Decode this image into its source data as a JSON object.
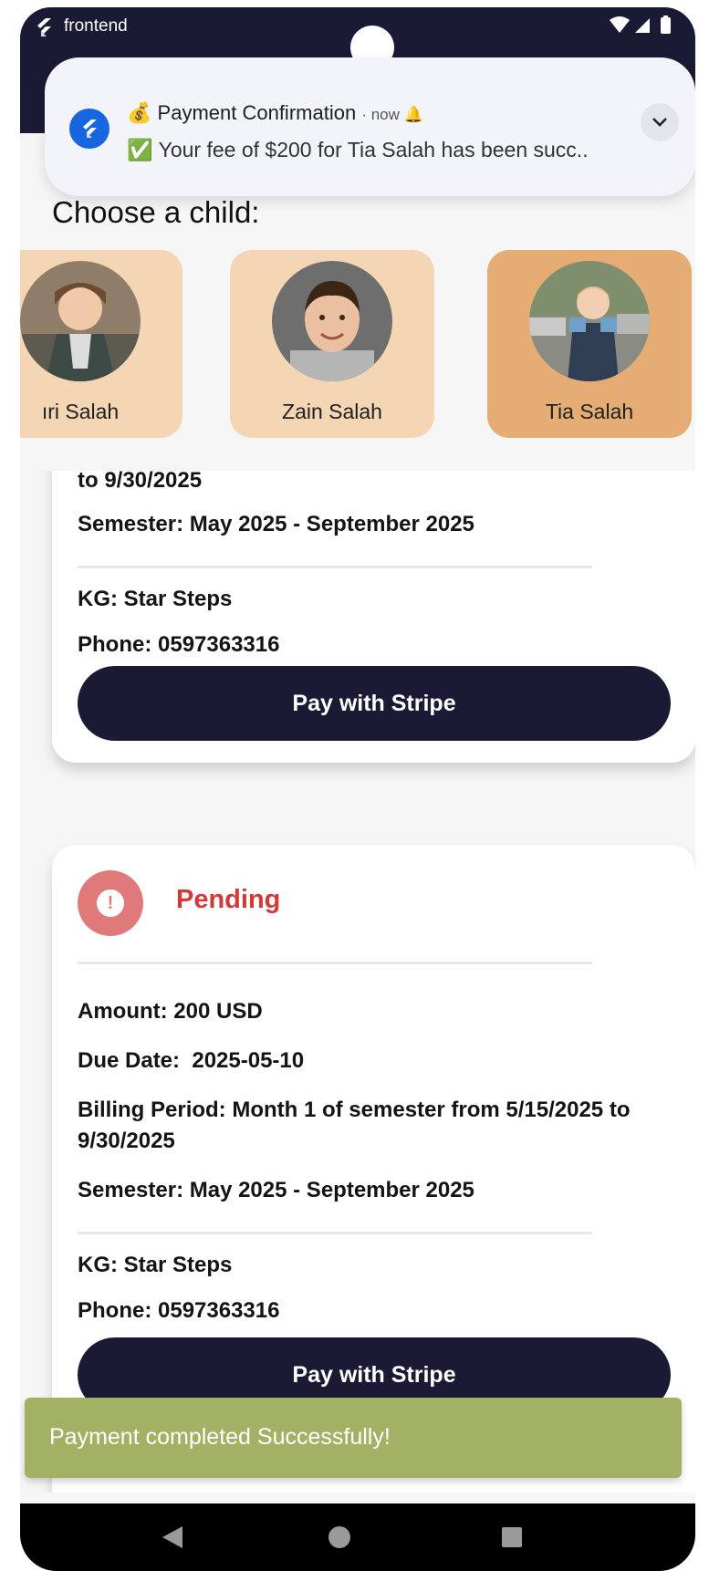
{
  "status_bar": {
    "app_name": "frontend",
    "icons": [
      "wifi-icon",
      "signal-icon",
      "battery-icon"
    ]
  },
  "notification": {
    "emoji": "💰",
    "title": "Payment Confirmation",
    "time": "now",
    "bell_glyph": "🔔",
    "body": "✅ Your fee of $200 for Tia Salah has been succ..",
    "app_icon": "flutter-logo-icon",
    "expand_icon": "chevron-down-icon"
  },
  "page": {
    "heading": "Choose a child:"
  },
  "children": [
    {
      "name": "Nouri Salah",
      "visible_label": "ıri Salah",
      "selected": false
    },
    {
      "name": "Zain Salah",
      "visible_label": "Zain Salah",
      "selected": false
    },
    {
      "name": "Tia Salah",
      "visible_label": "Tia Salah",
      "selected": true
    }
  ],
  "invoices": [
    {
      "visible_lines": {
        "billing_period_tail": "to 9/30/2025",
        "semester": "Semester: May 2025 - September 2025"
      },
      "kg": "KG: Star Steps",
      "phone": "Phone: 0597363316",
      "pay_label": "Pay with Stripe"
    },
    {
      "status": "Pending",
      "status_icon": "exclamation-icon",
      "amount": "Amount: 200 USD",
      "due_date": "Due Date:  2025-05-10",
      "billing_period": "Billing Period: Month 1 of semester from 5/15/2025 to 9/30/2025",
      "semester": "Semester: May 2025 - September 2025",
      "kg": "KG: Star Steps",
      "phone": "Phone: 0597363316",
      "pay_label": "Pay with Stripe"
    }
  ],
  "snackbar": {
    "message": "Payment completed Successfully!"
  },
  "nav_bar": {
    "buttons": [
      "back-icon",
      "home-icon",
      "recents-icon"
    ]
  },
  "colors": {
    "primary_navy": "#1b1a34",
    "child_card": "#f5d6b4",
    "child_card_selected": "#e5ad73",
    "pending_red": "#d23a3a",
    "snackbar_green": "#a3b164"
  }
}
